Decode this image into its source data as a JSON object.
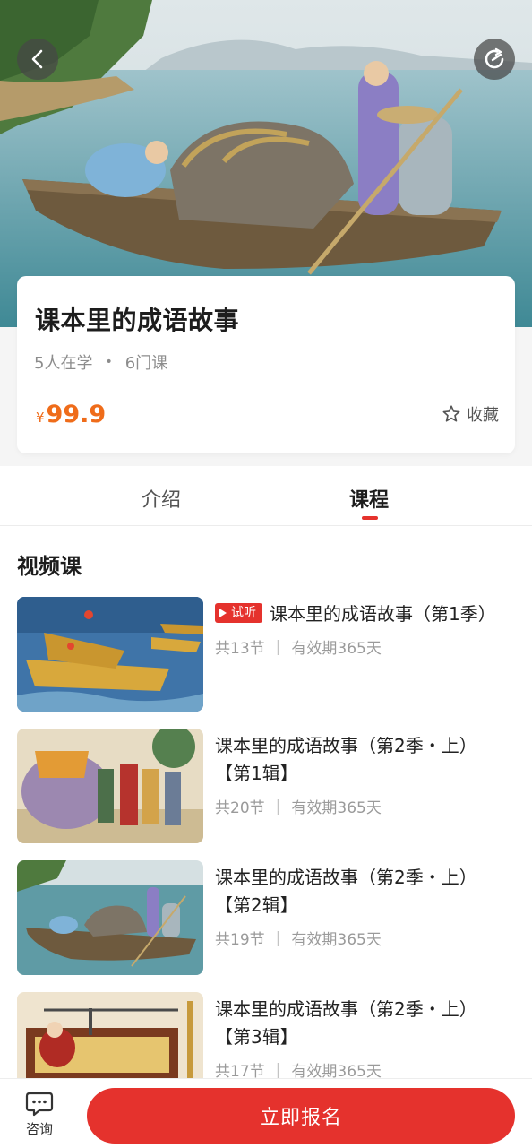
{
  "hero": {
    "back_icon": "chevron-left-icon",
    "share_icon": "refresh-share-icon"
  },
  "course": {
    "title": "课本里的成语故事",
    "learners": "5人在学",
    "dot": "•",
    "lessons": "6门课",
    "price_symbol": "¥",
    "price": "99.9",
    "favorite_label": "收藏"
  },
  "tabs": [
    {
      "label": "介绍"
    },
    {
      "label": "课程"
    }
  ],
  "active_tab": "课程",
  "section_title": "视频课",
  "items": [
    {
      "badge": "试听",
      "title": "课本里的成语故事（第1季）",
      "count": "共13节",
      "validity": "有效期365天"
    },
    {
      "title": "课本里的成语故事（第2季・上）【第1辑】",
      "count": "共20节",
      "validity": "有效期365天"
    },
    {
      "title": "课本里的成语故事（第2季・上）【第2辑】",
      "count": "共19节",
      "validity": "有效期365天"
    },
    {
      "title": "课本里的成语故事（第2季・上）【第3辑】",
      "count": "共17节",
      "validity": "有效期365天"
    }
  ],
  "separator": "|",
  "bottom": {
    "consult_label": "咨询",
    "enroll_label": "立即报名"
  },
  "colors": {
    "accent_red": "#e5322d",
    "price_orange": "#ef6c1a"
  }
}
